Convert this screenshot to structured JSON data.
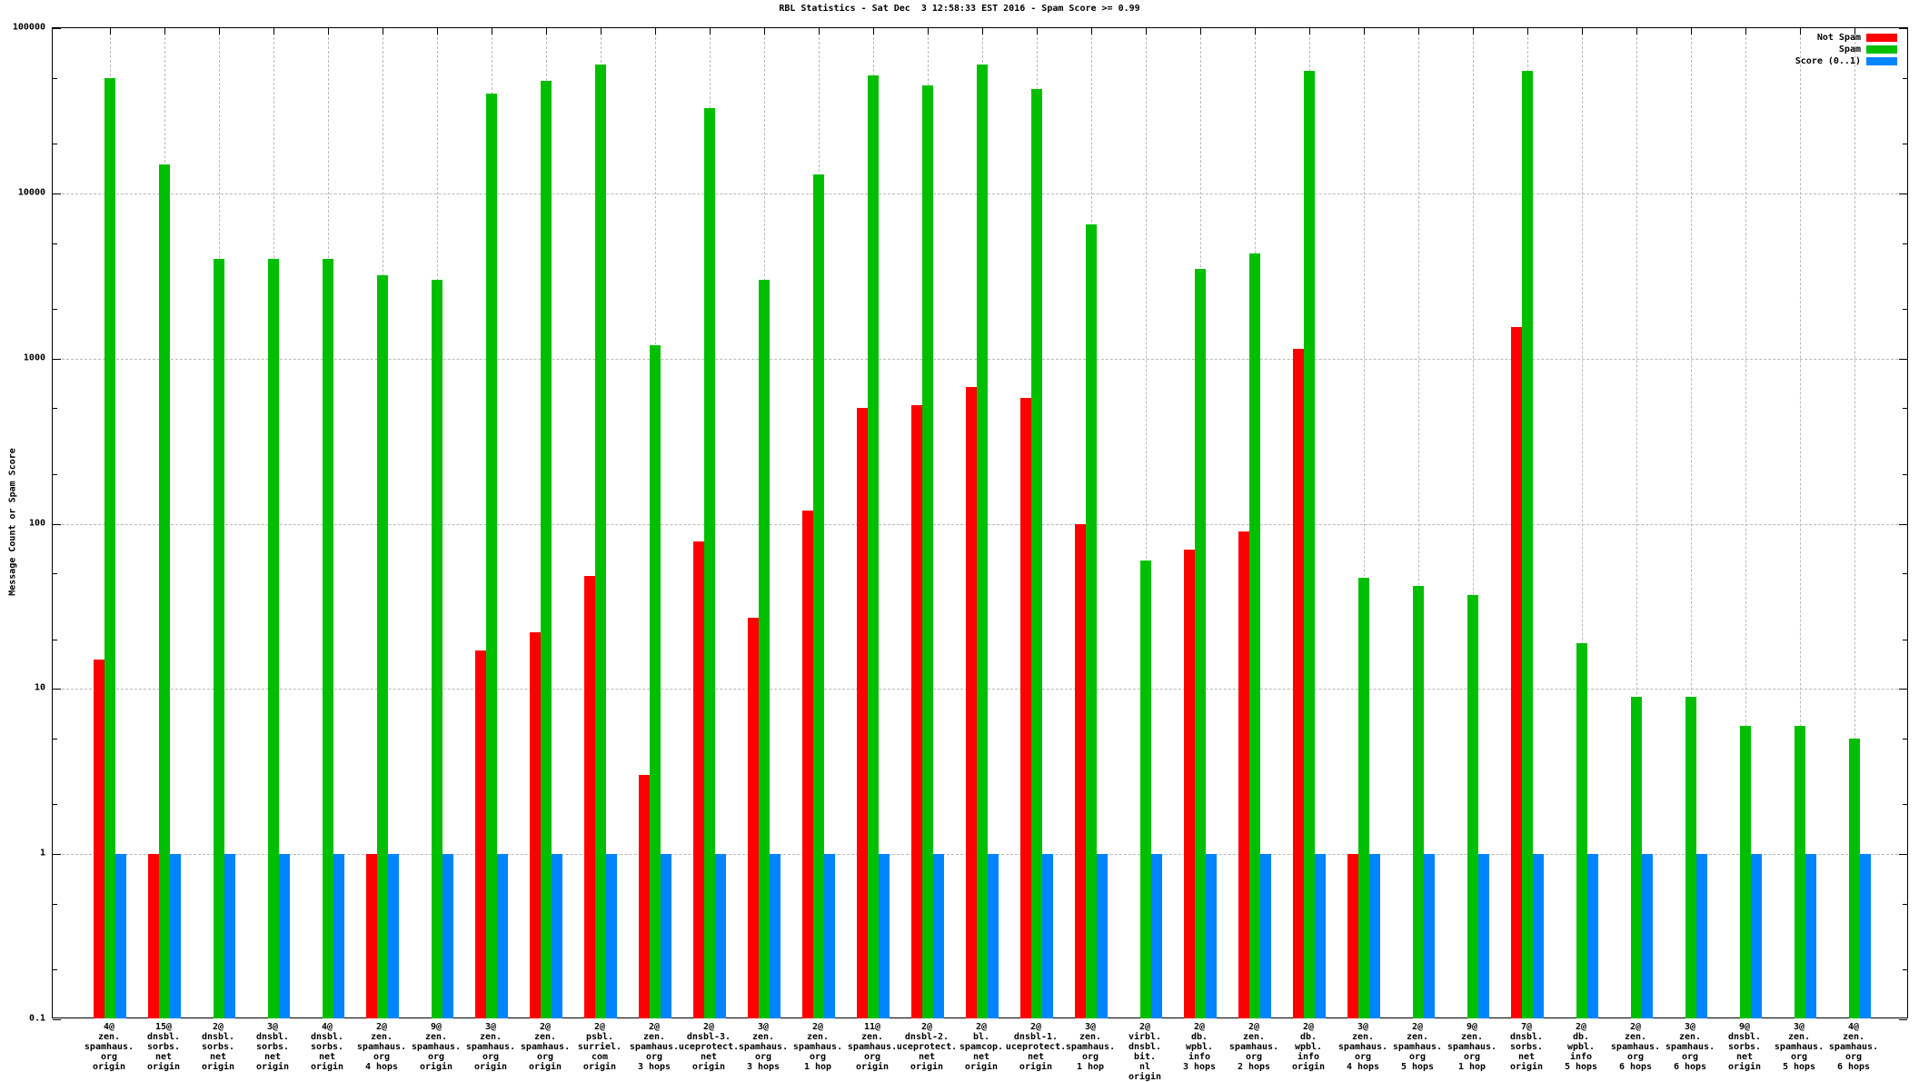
{
  "chart_data": {
    "type": "bar",
    "title": "RBL Statistics - Sat Dec  3 12:58:33 EST 2016 - Spam Score >= 0.99",
    "ylabel": "Message Count or Spam Score",
    "y_scale": "log",
    "ylim": [
      0.1,
      100000
    ],
    "y_ticks": [
      "100000",
      "10000",
      "1000",
      "100",
      "10",
      "1",
      "0.1"
    ],
    "grid": true,
    "legend_position": "top-right-inside",
    "colors": {
      "not_spam": "#ff0000",
      "spam": "#00bf00",
      "score": "#0084ff",
      "grid": "#b9b9b9",
      "axis": "#000000",
      "background": "#ffffff"
    },
    "legend": [
      {
        "name": "Not Spam",
        "color": "#ff0000"
      },
      {
        "name": "Spam",
        "color": "#00bf00"
      },
      {
        "name": "Score (0..1)",
        "color": "#0084ff"
      }
    ],
    "categories": [
      [
        "4@",
        "zen.",
        "spamhaus.",
        "org",
        "origin"
      ],
      [
        "15@",
        "dnsbl.",
        "sorbs.",
        "net",
        "origin"
      ],
      [
        "2@",
        "dnsbl.",
        "sorbs.",
        "net",
        "origin"
      ],
      [
        "3@",
        "dnsbl.",
        "sorbs.",
        "net",
        "origin"
      ],
      [
        "4@",
        "dnsbl.",
        "sorbs.",
        "net",
        "origin"
      ],
      [
        "2@",
        "zen.",
        "spamhaus.",
        "org",
        "4 hops"
      ],
      [
        "9@",
        "zen.",
        "spamhaus.",
        "org",
        "origin"
      ],
      [
        "3@",
        "zen.",
        "spamhaus.",
        "org",
        "origin"
      ],
      [
        "2@",
        "zen.",
        "spamhaus.",
        "org",
        "origin"
      ],
      [
        "2@",
        "psbl.",
        "surriel.",
        "com",
        "origin"
      ],
      [
        "2@",
        "zen.",
        "spamhaus.",
        "org",
        "3 hops"
      ],
      [
        "2@",
        "dnsbl-3.",
        "uceprotect.",
        "net",
        "origin"
      ],
      [
        "3@",
        "zen.",
        "spamhaus.",
        "org",
        "3 hops"
      ],
      [
        "2@",
        "zen.",
        "spamhaus.",
        "org",
        "1 hop"
      ],
      [
        "11@",
        "zen.",
        "spamhaus.",
        "org",
        "origin"
      ],
      [
        "2@",
        "dnsbl-2.",
        "uceprotect.",
        "net",
        "origin"
      ],
      [
        "2@",
        "bl.",
        "spamcop.",
        "net",
        "origin"
      ],
      [
        "2@",
        "dnsbl-1.",
        "uceprotect.",
        "net",
        "origin"
      ],
      [
        "3@",
        "zen.",
        "spamhaus.",
        "org",
        "1 hop"
      ],
      [
        "2@",
        "virbl.",
        "dnsbl.",
        "bit.",
        "nl",
        "origin"
      ],
      [
        "2@",
        "db.",
        "wpbl.",
        "info",
        "3 hops"
      ],
      [
        "2@",
        "zen.",
        "spamhaus.",
        "org",
        "2 hops"
      ],
      [
        "2@",
        "db.",
        "wpbl.",
        "info",
        "origin"
      ],
      [
        "3@",
        "zen.",
        "spamhaus.",
        "org",
        "4 hops"
      ],
      [
        "2@",
        "zen.",
        "spamhaus.",
        "org",
        "5 hops"
      ],
      [
        "9@",
        "zen.",
        "spamhaus.",
        "org",
        "1 hop"
      ],
      [
        "7@",
        "dnsbl.",
        "sorbs.",
        "net",
        "origin"
      ],
      [
        "2@",
        "db.",
        "wpbl.",
        "info",
        "5 hops"
      ],
      [
        "2@",
        "zen.",
        "spamhaus.",
        "org",
        "6 hops"
      ],
      [
        "3@",
        "zen.",
        "spamhaus.",
        "org",
        "6 hops"
      ],
      [
        "9@",
        "dnsbl.",
        "sorbs.",
        "net",
        "origin"
      ],
      [
        "3@",
        "zen.",
        "spamhaus.",
        "org",
        "5 hops"
      ],
      [
        "4@",
        "zen.",
        "spamhaus.",
        "org",
        "6 hops"
      ]
    ],
    "series": [
      {
        "name": "Not Spam",
        "color_key": "not_spam",
        "values": [
          15,
          1,
          null,
          null,
          null,
          1,
          null,
          17,
          22,
          48,
          3,
          78,
          27,
          120,
          500,
          520,
          670,
          580,
          100,
          null,
          70,
          90,
          1150,
          1,
          null,
          null,
          1550,
          null,
          null,
          null,
          null,
          null,
          null
        ]
      },
      {
        "name": "Spam",
        "color_key": "spam",
        "values": [
          50000,
          15000,
          4000,
          4000,
          4000,
          3200,
          3000,
          40000,
          48000,
          60000,
          1200,
          33000,
          3000,
          13000,
          52000,
          45000,
          60000,
          43000,
          6500,
          60,
          3500,
          4300,
          55000,
          47,
          42,
          37,
          55000,
          19,
          9,
          9,
          6,
          6,
          5
        ]
      },
      {
        "name": "Score (0..1)",
        "color_key": "score",
        "values": [
          1,
          1,
          1,
          1,
          1,
          1,
          1,
          1,
          1,
          1,
          1,
          1,
          1,
          1,
          1,
          1,
          1,
          1,
          1,
          1,
          1,
          1,
          1,
          1,
          1,
          1,
          1,
          1,
          1,
          1,
          1,
          1,
          1
        ]
      }
    ]
  }
}
